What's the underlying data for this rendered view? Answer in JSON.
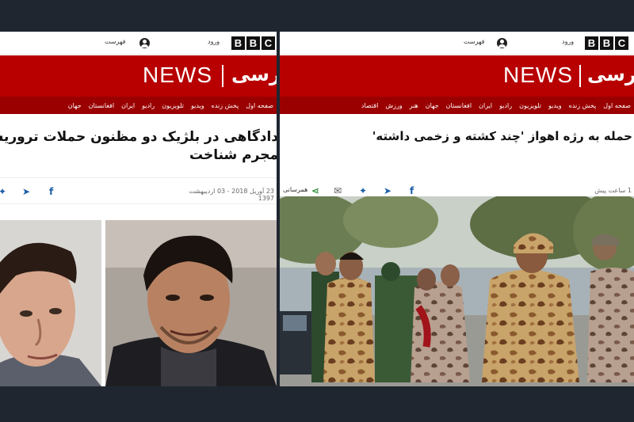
{
  "left": {
    "topbar": {
      "brand": [
        "B",
        "B",
        "C"
      ],
      "login": "ورود",
      "menu": "فهرست"
    },
    "banner": {
      "news": "NEWS",
      "farsi": "فارسی"
    },
    "nav": [
      "صفحه اول",
      "پخش زنده",
      "ویدیو",
      "تلویزیون",
      "رادیو",
      "ایران",
      "افغانستان",
      "جهان"
    ],
    "headline_line1": "دادگاهی در بلژیک دو مظنون حملات تروریستی",
    "headline_line2": "مجرم شناخت",
    "date": "23 آوریل 2018 - 03 اردیبهشت 1397",
    "colors": {
      "red": "#b80000",
      "nav": "#9b0000"
    }
  },
  "right": {
    "topbar": {
      "brand": [
        "B",
        "B",
        "C"
      ],
      "login": "ورود",
      "menu": "فهرست"
    },
    "banner": {
      "news": "NEWS",
      "farsi": "فارسی"
    },
    "nav": [
      "صفحه اول",
      "پخش زنده",
      "ویدیو",
      "تلویزیون",
      "رادیو",
      "ایران",
      "افغانستان",
      "جهان",
      "هنر",
      "ورزش",
      "اقتصاد"
    ],
    "headline": "حمله به رژه اهواز 'چند کشته و زخمی داشته'",
    "time": "1 ساعت پیش",
    "share_label": "همرسانی"
  }
}
